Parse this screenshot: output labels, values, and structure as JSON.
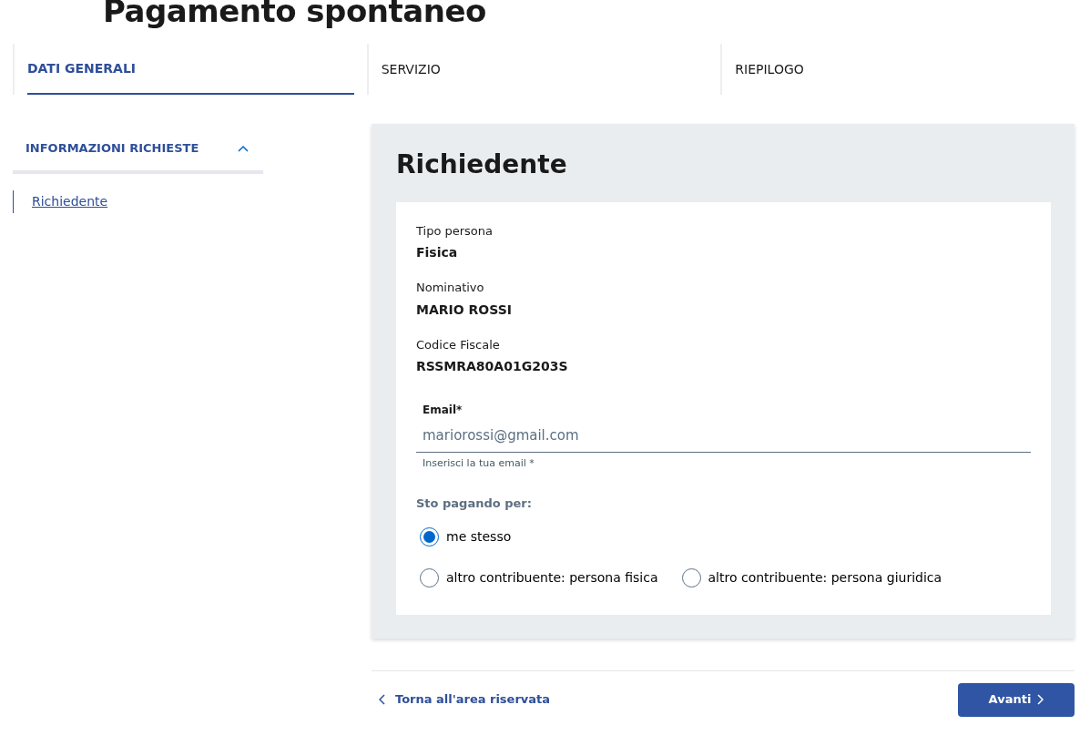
{
  "page_title": "Pagamento spontaneo",
  "steps": [
    {
      "label": "DATI GENERALI",
      "selected": true
    },
    {
      "label": "SERVIZIO",
      "selected": false
    },
    {
      "label": "RIEPILOGO",
      "selected": false
    }
  ],
  "sidebar": {
    "heading": "INFORMAZIONI RICHIESTE",
    "expanded": true,
    "items": [
      {
        "label": "Richiedente",
        "selected": true
      }
    ]
  },
  "section": {
    "title": "Richiedente",
    "fields": [
      {
        "label": "Tipo persona",
        "value": "Fisica"
      },
      {
        "label": "Nominativo",
        "value": "MARIO ROSSI"
      },
      {
        "label": "Codice Fiscale",
        "value": "RSSMRA80A01G203S"
      }
    ],
    "email": {
      "label": "Email*",
      "value": "mariorossi@gmail.com",
      "hint": "Inserisci la tua email *"
    },
    "payer_group": {
      "label": "Sto pagando per:",
      "options": [
        {
          "label": "me stesso",
          "selected": true
        },
        {
          "label": "altro contribuente: persona fisica",
          "selected": false
        },
        {
          "label": "altro contribuente: persona giuridica",
          "selected": false
        }
      ]
    }
  },
  "footer": {
    "back_link": "Torna all'area riservata",
    "next_button": "Avanti"
  }
}
